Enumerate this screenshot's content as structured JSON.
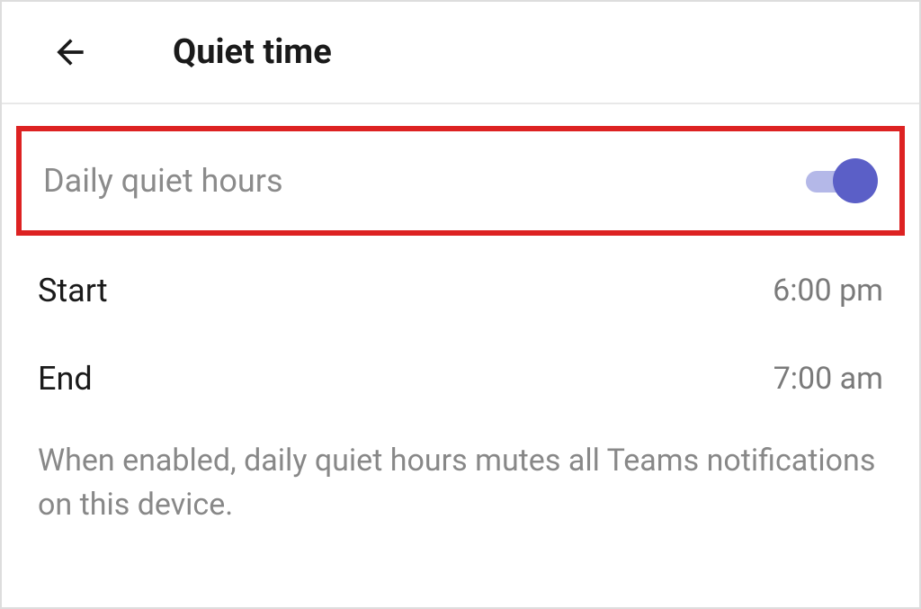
{
  "header": {
    "title": "Quiet time"
  },
  "settings": {
    "daily_quiet_hours": {
      "label": "Daily quiet hours",
      "enabled": true
    },
    "start": {
      "label": "Start",
      "value": "6:00 pm"
    },
    "end": {
      "label": "End",
      "value": "7:00 am"
    },
    "description": "When enabled, daily quiet hours mutes all Teams notifications on this device."
  }
}
